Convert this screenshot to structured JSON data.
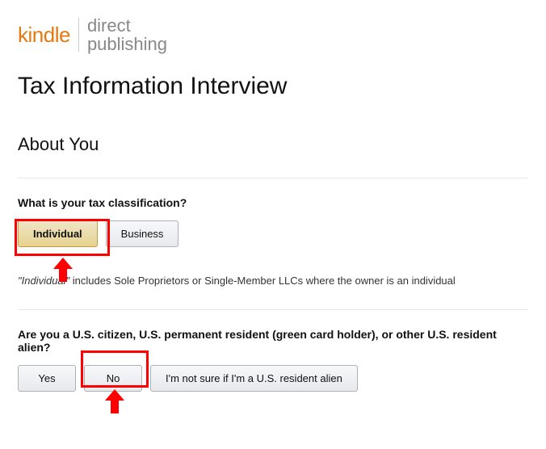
{
  "logo": {
    "kindle": "kindle",
    "direct": "direct",
    "publishing": "publishing"
  },
  "page_title": "Tax Information Interview",
  "section_title": "About You",
  "q1": {
    "label": "What is your tax classification?",
    "option_individual": "Individual",
    "option_business": "Business",
    "note_prefix": "\"Individual\"",
    "note_rest": " includes Sole Proprietors or Single-Member LLCs where the owner is an individual"
  },
  "q2": {
    "label": "Are you a U.S. citizen, U.S. permanent resident (green card holder), or other U.S. resident alien?",
    "option_yes": "Yes",
    "option_no": "No",
    "option_unsure": "I'm not sure if I'm a U.S. resident alien"
  }
}
